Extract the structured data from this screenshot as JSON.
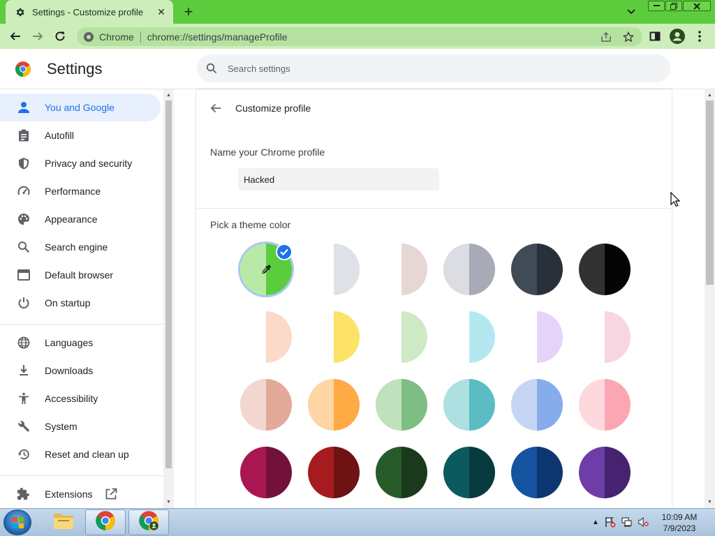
{
  "window": {
    "tab_title": "Settings - Customize profile",
    "new_tab_symbol": "+",
    "close_symbol": "✕"
  },
  "toolbar": {
    "site_label": "Chrome",
    "url": "chrome://settings/manageProfile"
  },
  "settings": {
    "title": "Settings",
    "search_placeholder": "Search settings"
  },
  "sidebar": {
    "items": [
      {
        "label": "You and Google",
        "icon": "person-icon",
        "active": true
      },
      {
        "label": "Autofill",
        "icon": "clipboard-icon"
      },
      {
        "label": "Privacy and security",
        "icon": "shield-icon"
      },
      {
        "label": "Performance",
        "icon": "speedometer-icon"
      },
      {
        "label": "Appearance",
        "icon": "palette-icon"
      },
      {
        "label": "Search engine",
        "icon": "magnifier-icon"
      },
      {
        "label": "Default browser",
        "icon": "browser-window-icon"
      },
      {
        "label": "On startup",
        "icon": "power-icon"
      },
      {
        "label": "Languages",
        "icon": "globe-icon"
      },
      {
        "label": "Downloads",
        "icon": "download-icon"
      },
      {
        "label": "Accessibility",
        "icon": "accessibility-icon"
      },
      {
        "label": "System",
        "icon": "wrench-icon"
      },
      {
        "label": "Reset and clean up",
        "icon": "restore-icon"
      },
      {
        "label": "Extensions",
        "icon": "puzzle-icon"
      }
    ]
  },
  "profile": {
    "page_title": "Customize profile",
    "name_label": "Name your Chrome profile",
    "name_value": "Hacked",
    "theme_label": "Pick a theme color",
    "selected_theme": 0
  },
  "themes": [
    {
      "left": "#b9e9a6",
      "right": "#5acd3c"
    },
    {
      "left": "#ffffff",
      "right": "#dee1e6"
    },
    {
      "left": "#ffffff",
      "right": "#e6d7d5"
    },
    {
      "left": "#dcdde3",
      "right": "#a8abb5"
    },
    {
      "left": "#3f4b57",
      "right": "#283039"
    },
    {
      "left": "#323232",
      "right": "#050505"
    },
    {
      "left": "#ffffff",
      "right": "#fdd9c9"
    },
    {
      "left": "#ffffff",
      "right": "#fce266"
    },
    {
      "left": "#ffffff",
      "right": "#cdeac5"
    },
    {
      "left": "#ffffff",
      "right": "#b4e8f1"
    },
    {
      "left": "#ffffff",
      "right": "#e6d3fa"
    },
    {
      "left": "#ffffff",
      "right": "#f7d6e2"
    },
    {
      "left": "#f1d7cf",
      "right": "#e3a999"
    },
    {
      "left": "#fed6a4",
      "right": "#feaa45"
    },
    {
      "left": "#bfe1bd",
      "right": "#7ebe82"
    },
    {
      "left": "#aee0e2",
      "right": "#5bbcc4"
    },
    {
      "left": "#c5d6f5",
      "right": "#86aceb"
    },
    {
      "left": "#ffd8de",
      "right": "#fba7b3"
    },
    {
      "left": "#a91752",
      "right": "#72113a"
    },
    {
      "left": "#a71b1e",
      "right": "#6f1213"
    },
    {
      "left": "#275b2a",
      "right": "#1a3b1b"
    },
    {
      "left": "#0c5a5f",
      "right": "#073b3e"
    },
    {
      "left": "#1553a1",
      "right": "#0e3670"
    },
    {
      "left": "#6e3da7",
      "right": "#452370"
    }
  ],
  "taskbar": {
    "time": "10:09 AM",
    "date": "7/9/2023"
  }
}
